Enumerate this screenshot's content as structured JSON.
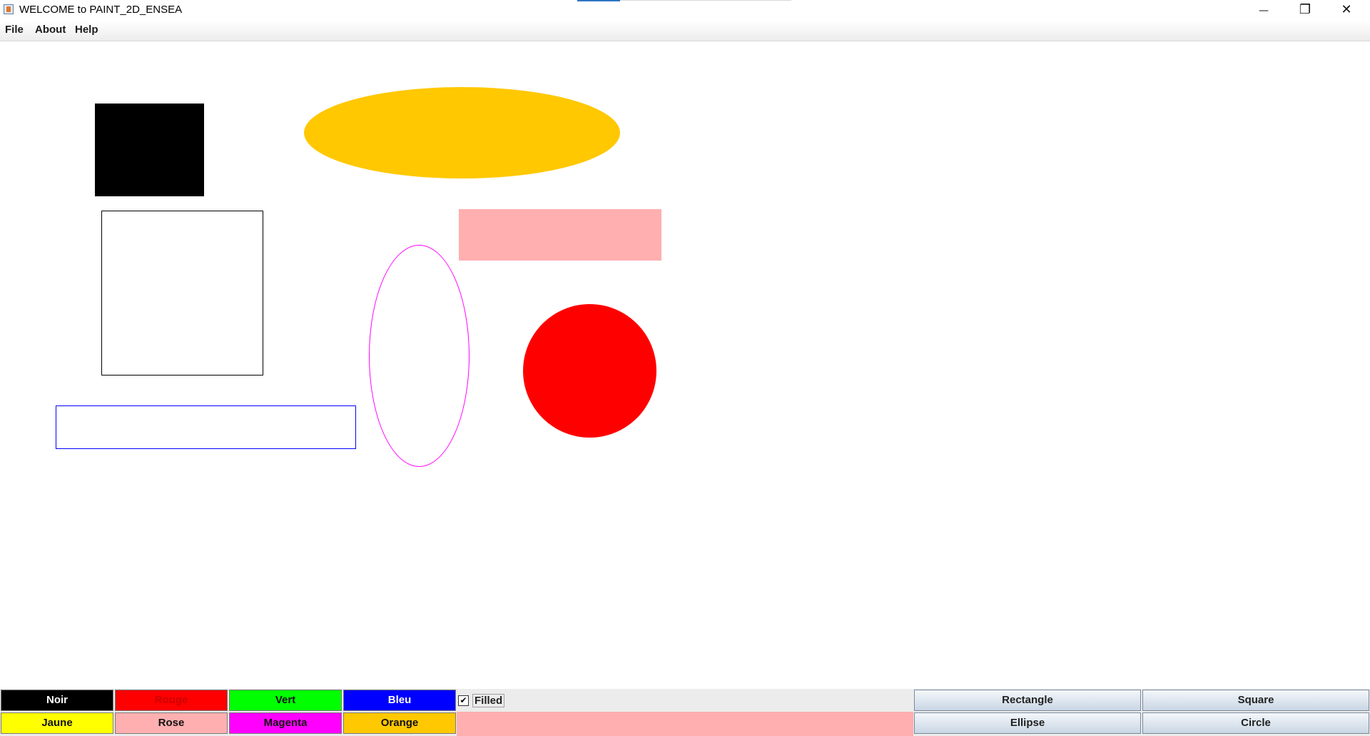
{
  "window": {
    "title": "WELCOME to PAINT_2D_ENSEA",
    "controls": {
      "minimize": "—",
      "maximize": "❐",
      "close": "✕"
    }
  },
  "menu": {
    "items": [
      "File",
      "About",
      "Help"
    ]
  },
  "canvas": {
    "shapes": [
      {
        "type": "square",
        "color": "#000000",
        "filled": true
      },
      {
        "type": "ellipse",
        "color": "#FFC800",
        "filled": true
      },
      {
        "type": "square",
        "color": "#000000",
        "filled": false
      },
      {
        "type": "rectangle",
        "color": "#FFAFAF",
        "filled": true
      },
      {
        "type": "ellipse",
        "color": "#FF00FF",
        "filled": false
      },
      {
        "type": "circle",
        "color": "#FF0000",
        "filled": true
      },
      {
        "type": "rectangle",
        "color": "#0000FF",
        "filled": false
      }
    ]
  },
  "colors": [
    {
      "label": "Noir",
      "bg": "#000000",
      "fg": "#ffffff"
    },
    {
      "label": "Rouge",
      "bg": "#ff0000",
      "fg": "#cc0000"
    },
    {
      "label": "Vert",
      "bg": "#00ff00",
      "fg": "#111111"
    },
    {
      "label": "Bleu",
      "bg": "#0000ff",
      "fg": "#ffffff"
    },
    {
      "label": "Jaune",
      "bg": "#ffff00",
      "fg": "#111111"
    },
    {
      "label": "Rose",
      "bg": "#ffafaf",
      "fg": "#111111"
    },
    {
      "label": "Magenta",
      "bg": "#ff00ff",
      "fg": "#111111"
    },
    {
      "label": "Orange",
      "bg": "#ffc800",
      "fg": "#111111"
    }
  ],
  "filled": {
    "label": "Filled",
    "checked": true,
    "check_glyph": "✔"
  },
  "current_color": "#ffafaf",
  "shape_buttons": [
    "Rectangle",
    "Square",
    "Ellipse",
    "Circle"
  ]
}
